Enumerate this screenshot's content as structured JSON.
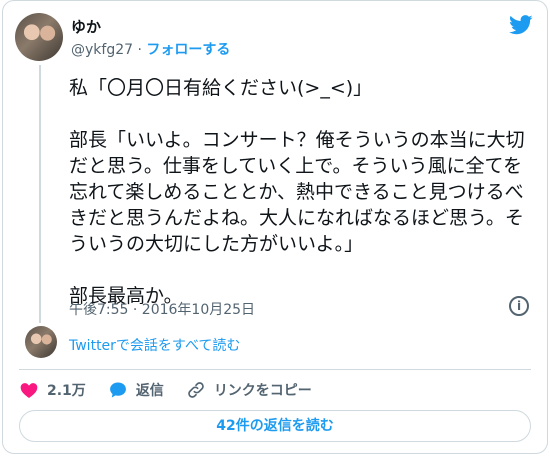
{
  "author": {
    "name": "ゆか",
    "handle": "@ykfg27",
    "separator": " · ",
    "follow_label": "フォローする"
  },
  "tweet": {
    "text": "私「〇月〇日有給ください(>_<)」\n\n部長「いいよ。コンサート？俺そういうの本当に大切だと思う。仕事をしていく上で。そういう風に全てを忘れて楽しめることとか、熱中できること見つけるべきだと思うんだよね。大人になればなるほど思う。そういうの大切にした方がいいよ。」\n\n部長最高か。",
    "timestamp": "午後7:55 · 2016年10月25日"
  },
  "conversation_link": "Twitterで会話をすべて読む",
  "actions": {
    "like_count": "2.1万",
    "reply_label": "返信",
    "copy_link_label": "リンクをコピー"
  },
  "replies_button": "42件の返信を読む",
  "icons": {
    "brand": "twitter-bird-icon",
    "info": "info-icon",
    "like": "heart-icon",
    "reply": "speech-bubble-icon",
    "link": "link-icon"
  },
  "colors": {
    "accent": "#1d9bf0",
    "like": "#f91880",
    "text": "#0f1419",
    "muted": "#536471",
    "border": "#cfd9de"
  }
}
